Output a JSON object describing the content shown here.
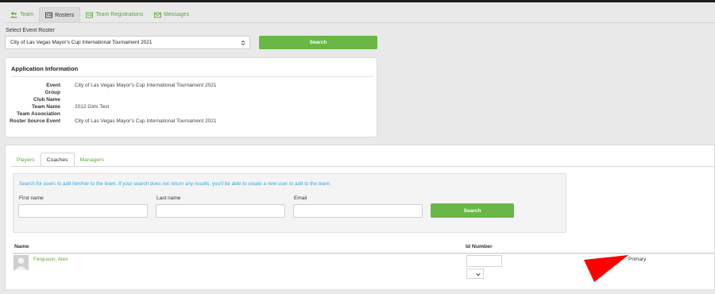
{
  "tabs": [
    {
      "label": "Team",
      "icon": "users-icon"
    },
    {
      "label": "Rosters",
      "icon": "id-card-icon"
    },
    {
      "label": "Team Registrations",
      "icon": "id-card-icon"
    },
    {
      "label": "Messages",
      "icon": "envelope-icon"
    }
  ],
  "event_roster": {
    "label": "Select Event Roster",
    "selected": "City of Las Vegas Mayor's Cup International Tournament 2021",
    "search_label": "Search"
  },
  "application": {
    "title": "Application Information",
    "rows": [
      {
        "key": "Event",
        "value": "City of Las Vegas Mayor's Cup International Tournament 2021"
      },
      {
        "key": "Group",
        "value": ""
      },
      {
        "key": "Club Name",
        "value": ""
      },
      {
        "key": "Team Name",
        "value": "2012 Girls Test"
      },
      {
        "key": "Team Association",
        "value": ""
      },
      {
        "key": "Roster Source Event",
        "value": "City of Las Vegas Mayor's Cup International Tournament 2021"
      }
    ]
  },
  "subtabs": [
    {
      "label": "Players"
    },
    {
      "label": "Coaches"
    },
    {
      "label": "Managers"
    }
  ],
  "coach_search": {
    "hint": "Search for users to add him/her to the team. If your search does not return any results, you'll be able to create a new user to add to the team.",
    "first_name_label": "First name",
    "last_name_label": "Last name",
    "email_label": "Email",
    "search_label": "Search"
  },
  "table": {
    "col_name": "Name",
    "col_id": "Id Number",
    "rows": [
      {
        "name": "Ferguson, Alex",
        "id_number": "",
        "role": "Primary"
      }
    ]
  },
  "colors": {
    "accent_green": "#69b744",
    "link_green": "#5aa93a",
    "hint_blue": "#3ea3d8",
    "annotation_red": "#ff0000"
  }
}
